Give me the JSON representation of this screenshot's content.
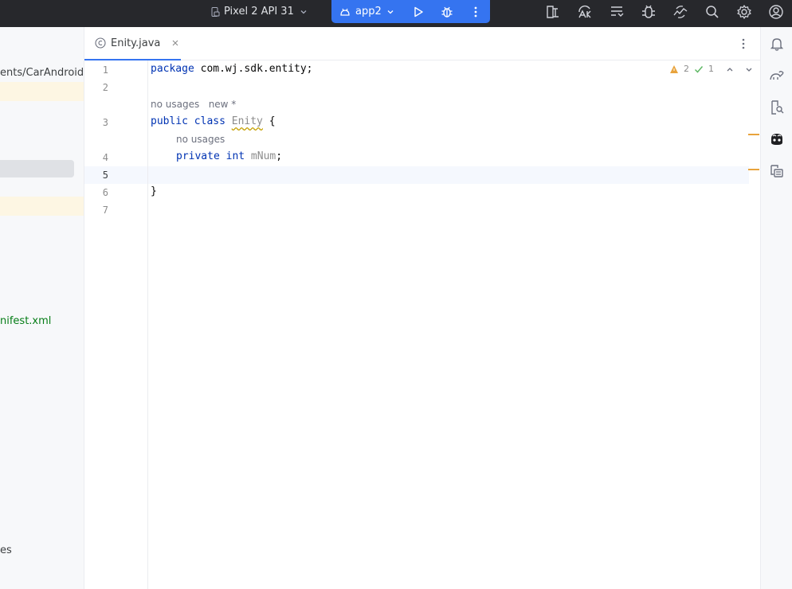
{
  "toolbar": {
    "device_label": "Pixel 2 API 31",
    "run_config_label": "app2",
    "accent_color": "#3574f0",
    "icons": [
      "device-manager-icon",
      "translate-icon",
      "structure-icon",
      "bug-icon",
      "cloud-icon",
      "search-icon",
      "gear-icon",
      "account-icon"
    ]
  },
  "project_panel": {
    "path_fragment": "ents/CarAndroid",
    "manifest_fragment": "nifest.xml",
    "bottom_fragment": "es"
  },
  "editor": {
    "tab": {
      "label": "Enity.java"
    },
    "inspections": {
      "warnings": "2",
      "ok": "1"
    },
    "line_numbers": [
      "1",
      "2",
      "3",
      "4",
      "5",
      "6",
      "7"
    ],
    "code": {
      "line1_kw": "package",
      "line1_rest": " com.wj.sdk.entity;",
      "hint_usages": "no usages",
      "hint_new": "new *",
      "line3_kw": "public class",
      "line3_class": "Enity",
      "line3_rest": " {",
      "hint_field_usages": "no usages",
      "line4_kw": "private int",
      "line4_field": "mNum",
      "line4_rest": ";",
      "line6": "}"
    }
  },
  "right_strip": {
    "icons": [
      "notifications-icon",
      "gradle-icon",
      "device-explorer-icon",
      "copilot-icon",
      "logcat-icon"
    ]
  }
}
